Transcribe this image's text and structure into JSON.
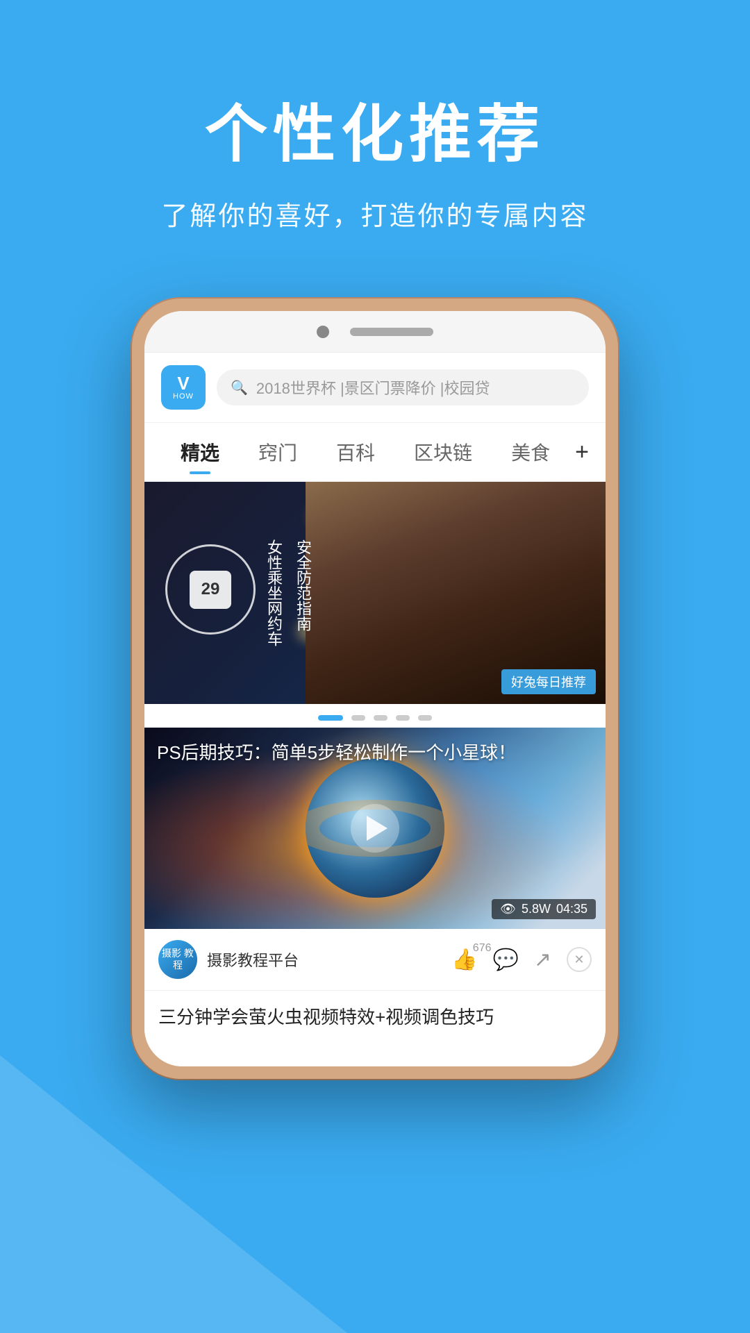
{
  "background": {
    "color": "#3AABF0"
  },
  "header": {
    "main_title": "个性化推荐",
    "sub_title": "了解你的喜好，打造你的专属内容"
  },
  "phone": {
    "app_logo": {
      "letter": "V",
      "text": "HOW"
    },
    "search": {
      "placeholder": "2018世界杯 |景区门票降价 |校园贷"
    },
    "nav_tabs": [
      {
        "label": "精选",
        "active": true
      },
      {
        "label": "窍门",
        "active": false
      },
      {
        "label": "百科",
        "active": false
      },
      {
        "label": "区块链",
        "active": false
      },
      {
        "label": "美食",
        "active": false
      }
    ],
    "nav_plus": "+",
    "banner": {
      "calendar_day": "29",
      "text_col1": "女性乘坐网约车",
      "text_col2": "安全防范指南",
      "tag": "好兔每日推荐"
    },
    "carousel_dots": 5,
    "video": {
      "title": "PS后期技巧：简单5步轻松制作一个小星球！",
      "views": "5.8W",
      "duration": "04:35"
    },
    "author": {
      "avatar_text": "摄影\n教程",
      "name": "摄影教程平台",
      "likes": "676"
    },
    "next_title": "三分钟学会萤火虫视频特效+视频调色技巧"
  }
}
